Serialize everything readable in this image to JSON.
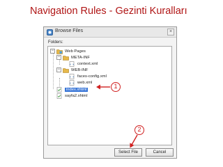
{
  "slide": {
    "title": "Navigation Rules - Gezinti Kuralları"
  },
  "dialog": {
    "title": "Browse Files",
    "close_glyph": "×",
    "folders_label": "Folders:",
    "tree": [
      {
        "label": "Web Pages",
        "icon": "web-folder-icon",
        "toggle": "−"
      },
      {
        "label": "META-INF",
        "icon": "folder-icon",
        "toggle": "−"
      },
      {
        "label": "context.xml",
        "icon": "xml-file-icon"
      },
      {
        "label": "WEB-INF",
        "icon": "folder-icon",
        "toggle": "−"
      },
      {
        "label": "faces-config.xml",
        "icon": "xml-file-icon"
      },
      {
        "label": "web.xml",
        "icon": "xml-file-icon"
      },
      {
        "label": "index.xhtml",
        "icon": "xhtml-file-icon",
        "selected": true
      },
      {
        "label": "sayfa2.xhtml",
        "icon": "xhtml-file-icon"
      }
    ],
    "buttons": {
      "select": "Select File",
      "cancel": "Cancel"
    }
  },
  "callouts": {
    "one": "1",
    "two": "2"
  },
  "colors": {
    "title": "#b01515",
    "callout": "#d02020",
    "selection": "#3875d7"
  }
}
